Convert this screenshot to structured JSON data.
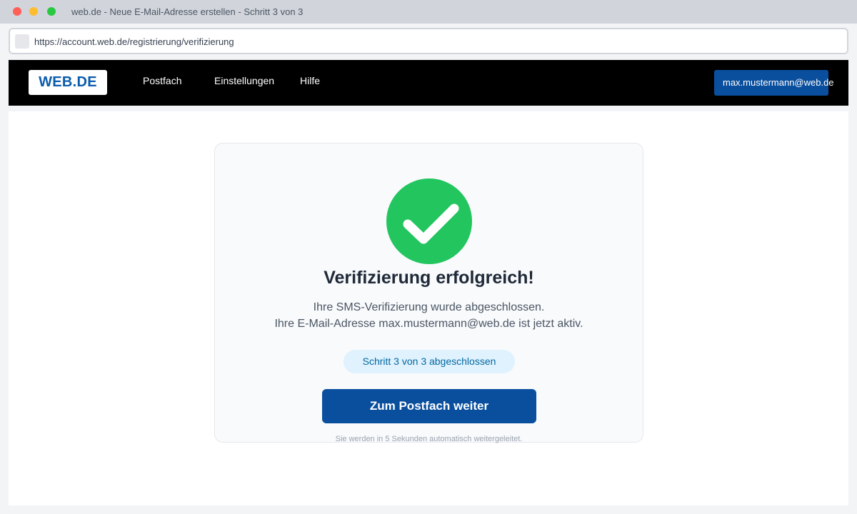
{
  "window": {
    "title": "web.de - Neue E-Mail-Adresse erstellen - Schritt 3 von 3"
  },
  "address_bar": {
    "url": "https://account.web.de/registrierung/verifizierung"
  },
  "navbar": {
    "logo": "WEB.DE",
    "links": [
      "Postfach",
      "Einstellungen",
      "Hilfe"
    ],
    "user_email": "max.mustermann@web.de"
  },
  "card": {
    "icon": "checkmark-icon",
    "title": "Verifizierung erfolgreich!",
    "description_line1": "Ihre SMS-Verifizierung wurde abgeschlossen.",
    "description_line2": "Ihre E-Mail-Adresse max.mustermann@web.de ist jetzt aktiv.",
    "step_status": "Schritt 3 von 3 abgeschlossen",
    "button_label": "Zum Postfach weiter",
    "redirect_note": "Sie werden in 5 Sekunden automatisch weitergeleitet."
  },
  "colors": {
    "brand_blue": "#0a4f9e",
    "success_green": "#22c55e",
    "nav_background": "#000000"
  }
}
